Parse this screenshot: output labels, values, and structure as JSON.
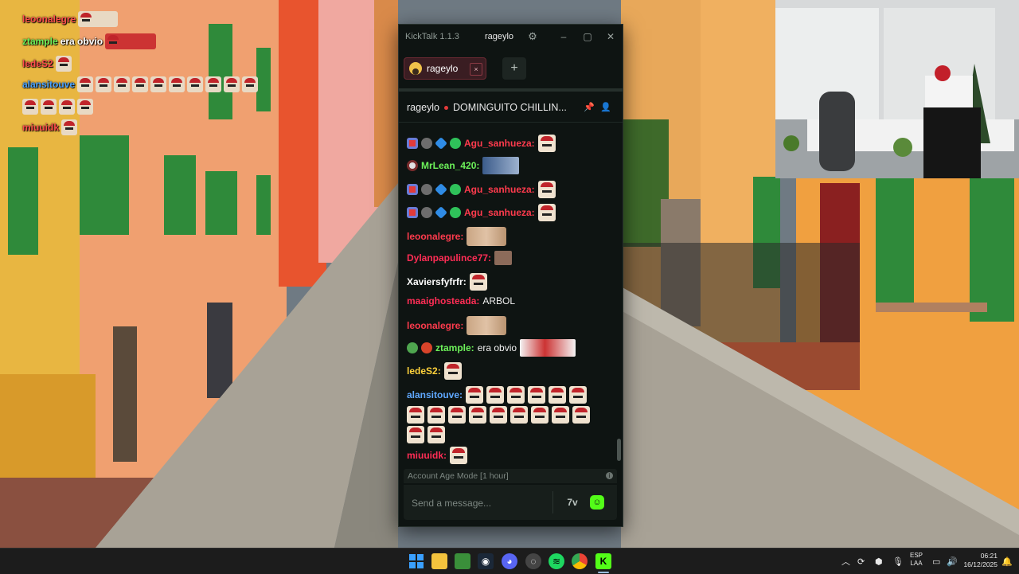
{
  "overlay_chat": {
    "lines": [
      {
        "user": "leoonalegre",
        "text": ""
      },
      {
        "user": "ztample",
        "text": "era obvio"
      },
      {
        "user": "ledeS2",
        "text": ""
      },
      {
        "user": "alansitouve",
        "text": ""
      },
      {
        "user": "miuuidk",
        "text": ""
      }
    ]
  },
  "kicktalk": {
    "app_title": "KickTalk 1.1.3",
    "account": "rageylo",
    "tab": {
      "label": "rageylo",
      "close": "×"
    },
    "add_tab": "+",
    "channel": {
      "name": "rageylo",
      "title": "DOMINGUITO CHILLIN..."
    },
    "messages": [
      {
        "user": "Agu_sanhueza:",
        "text": ""
      },
      {
        "user": "MrLean_420:",
        "text": ""
      },
      {
        "user": "Agu_sanhueza:",
        "text": ""
      },
      {
        "user": "Agu_sanhueza:",
        "text": ""
      },
      {
        "user": "leoonalegre:",
        "text": ""
      },
      {
        "user": "Dylanpapulince77:",
        "text": ""
      },
      {
        "user": "Xaviersfyfrfr:",
        "text": ""
      },
      {
        "user": "maaighosteada:",
        "text": "ARBOL"
      },
      {
        "user": "leoonalegre:",
        "text": ""
      },
      {
        "user": "ztample:",
        "text": "era obvio"
      },
      {
        "user": "ledeS2:",
        "text": ""
      },
      {
        "user": "alansitouve:",
        "text": ""
      },
      {
        "user": "miuuidk:",
        "text": ""
      }
    ],
    "mode_bar": "Account Age Mode [1 hour]",
    "input_placeholder": "Send a message...",
    "button_7tv": "7v"
  },
  "taskbar": {
    "language": [
      "ESP",
      "LAA"
    ],
    "time": "06:21",
    "date": "16/12/2025"
  },
  "colors": {
    "kick_green": "#53fc18",
    "window_bg": "#0e1412",
    "tab_bg": "#3a1d22"
  }
}
